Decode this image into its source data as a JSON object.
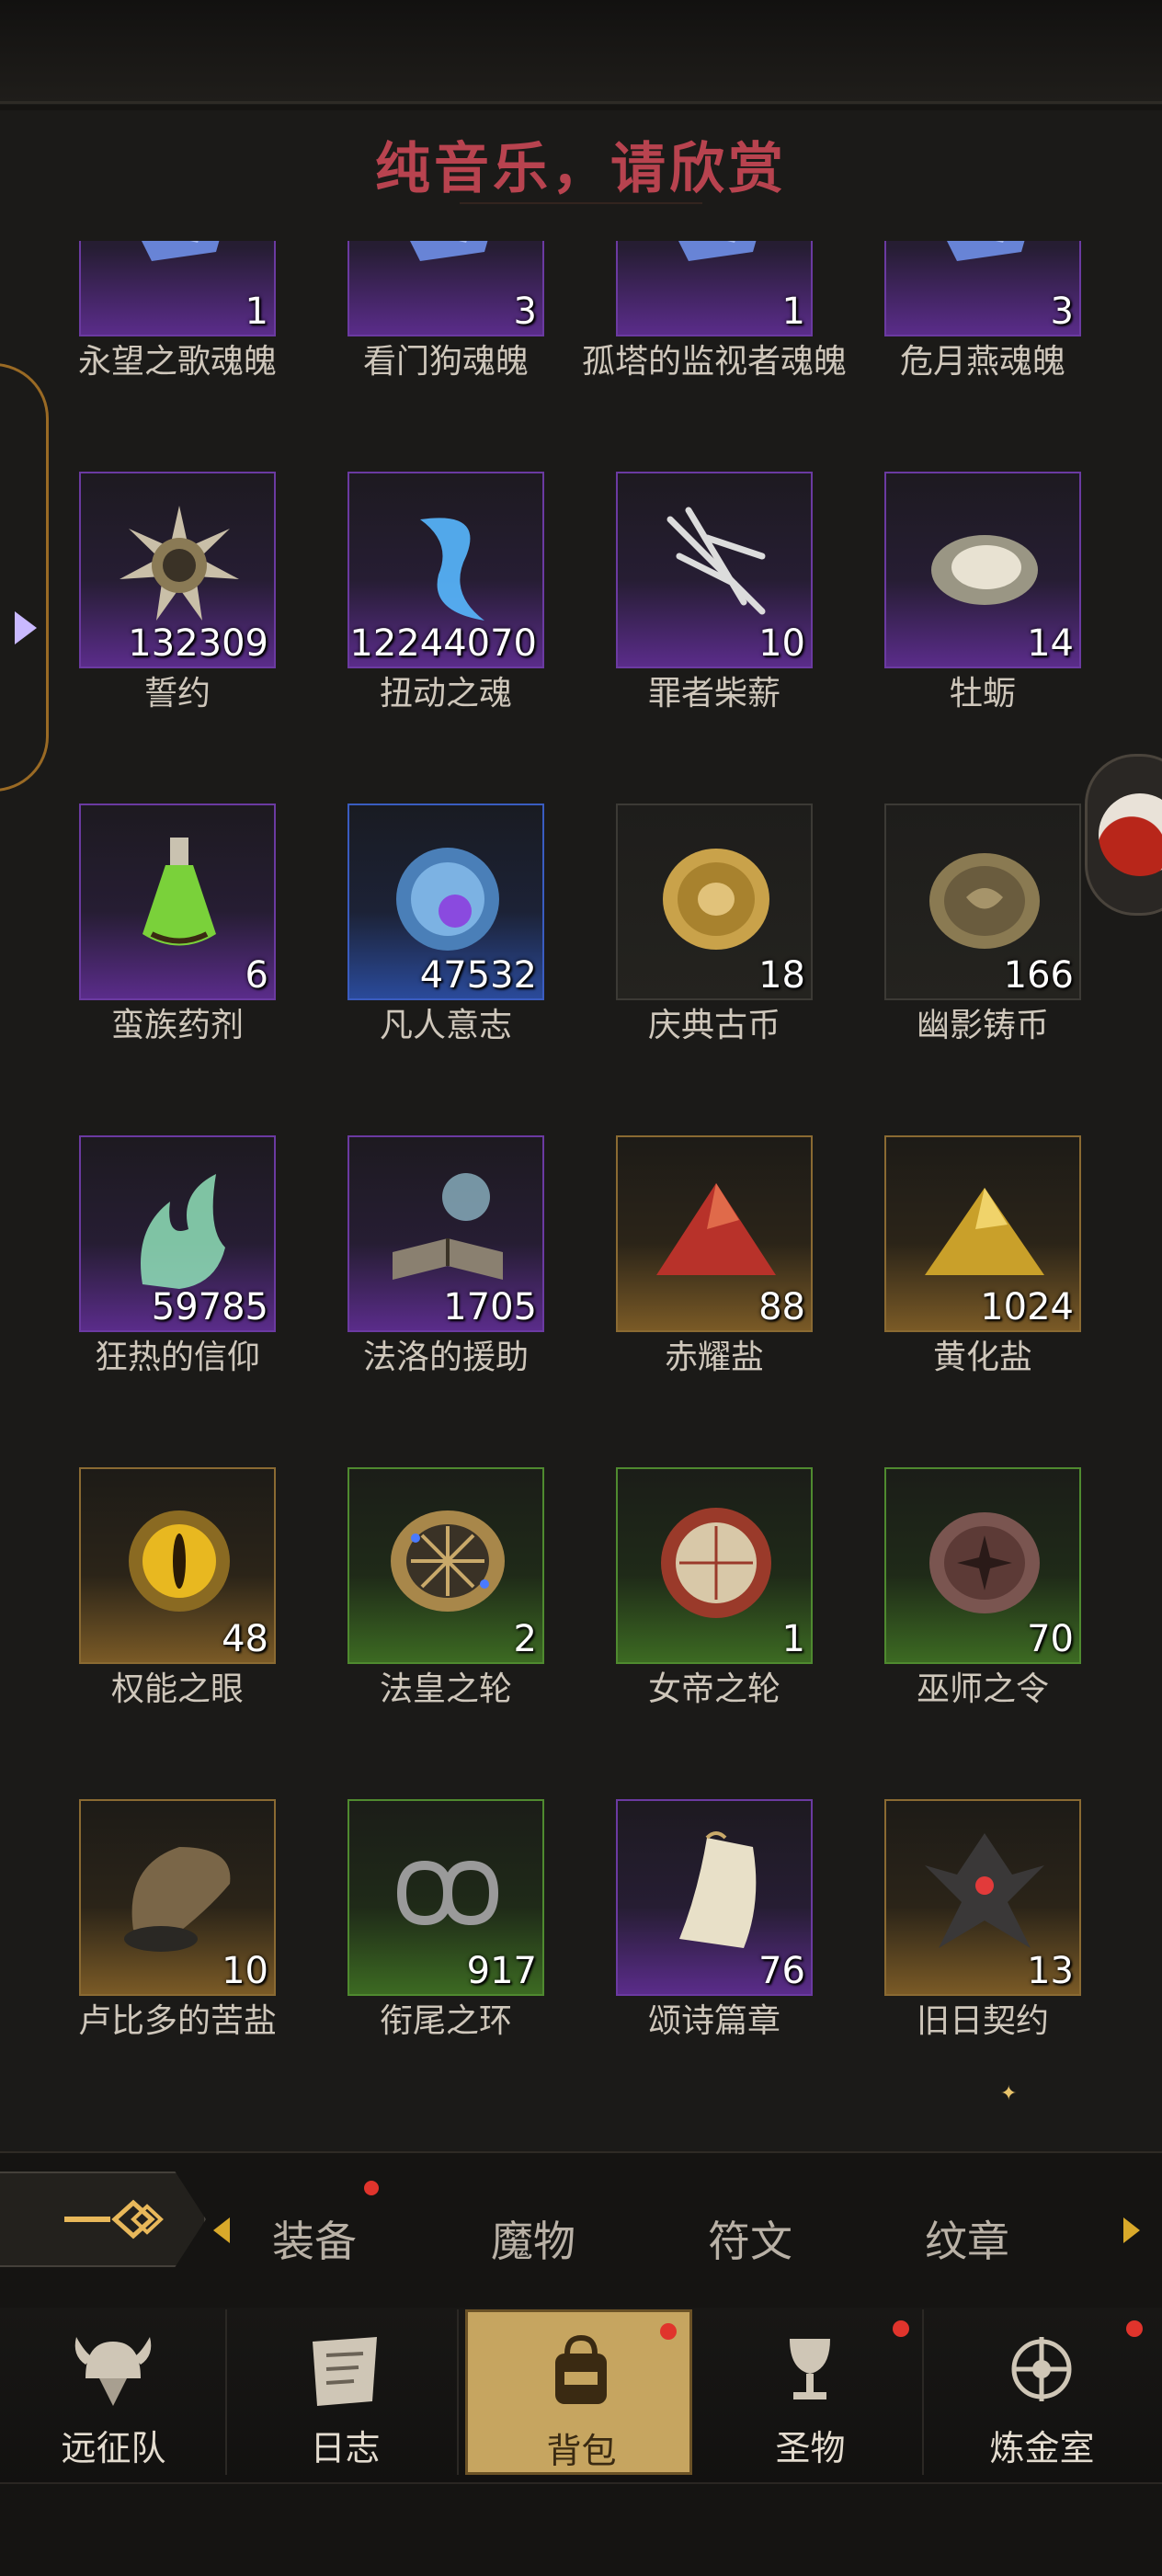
{
  "header": {
    "title": "纯音乐，请欣赏",
    "title_color": "#b8434f"
  },
  "items": [
    {
      "name": "永望之歌魂魄",
      "count": "1",
      "rarity": "purple",
      "icon": "crystal-icon"
    },
    {
      "name": "看门狗魂魄",
      "count": "3",
      "rarity": "purple",
      "icon": "crystal-icon"
    },
    {
      "name": "孤塔的监视者魂魄",
      "count": "1",
      "rarity": "purple",
      "icon": "crystal-icon"
    },
    {
      "name": "危月燕魂魄",
      "count": "3",
      "rarity": "purple",
      "icon": "crystal-icon"
    },
    {
      "name": "誓约",
      "count": "132309",
      "rarity": "purple",
      "icon": "star-seal-icon"
    },
    {
      "name": "扭动之魂",
      "count": "12244070",
      "rarity": "purple",
      "icon": "spirit-icon"
    },
    {
      "name": "罪者柴薪",
      "count": "10",
      "rarity": "purple",
      "icon": "branches-icon"
    },
    {
      "name": "牡蛎",
      "count": "14",
      "rarity": "purple",
      "icon": "oyster-icon"
    },
    {
      "name": "蛮族药剂",
      "count": "6",
      "rarity": "purple",
      "icon": "potion-icon"
    },
    {
      "name": "凡人意志",
      "count": "47532",
      "rarity": "blue",
      "icon": "orb-icon"
    },
    {
      "name": "庆典古币",
      "count": "18",
      "rarity": "grey",
      "icon": "gold-coin-icon"
    },
    {
      "name": "幽影铸币",
      "count": "166",
      "rarity": "grey",
      "icon": "bronze-coin-icon"
    },
    {
      "name": "狂热的信仰",
      "count": "59785",
      "rarity": "purple",
      "icon": "flame-icon"
    },
    {
      "name": "法洛的援助",
      "count": "1705",
      "rarity": "purple",
      "icon": "book-icon"
    },
    {
      "name": "赤耀盐",
      "count": "88",
      "rarity": "gold",
      "icon": "red-salt-icon"
    },
    {
      "name": "黄化盐",
      "count": "1024",
      "rarity": "gold",
      "icon": "yellow-salt-icon"
    },
    {
      "name": "权能之眼",
      "count": "48",
      "rarity": "gold",
      "icon": "eye-icon"
    },
    {
      "name": "法皇之轮",
      "count": "2",
      "rarity": "green",
      "icon": "wheel-icon"
    },
    {
      "name": "女帝之轮",
      "count": "1",
      "rarity": "green",
      "icon": "red-wheel-icon"
    },
    {
      "name": "巫师之令",
      "count": "70",
      "rarity": "green",
      "icon": "seal-coin-icon"
    },
    {
      "name": "卢比多的苦盐",
      "count": "10",
      "rarity": "gold",
      "icon": "salt-bag-icon"
    },
    {
      "name": "衔尾之环",
      "count": "917",
      "rarity": "green",
      "icon": "infinity-ring-icon"
    },
    {
      "name": "颂诗篇章",
      "count": "76",
      "rarity": "purple",
      "icon": "scroll-icon"
    },
    {
      "name": "旧日契约",
      "count": "13",
      "rarity": "gold",
      "icon": "dark-sigil-icon"
    }
  ],
  "category_tabs": {
    "items": [
      {
        "label": "装备",
        "has_dot": true
      },
      {
        "label": "魔物",
        "has_dot": false
      },
      {
        "label": "符文",
        "has_dot": false
      },
      {
        "label": "纹章",
        "has_dot": false
      }
    ]
  },
  "nav": {
    "items": [
      {
        "label": "远征队",
        "icon": "viking-helmet-icon",
        "active": false,
        "has_dot": false
      },
      {
        "label": "日志",
        "icon": "map-scroll-icon",
        "active": false,
        "has_dot": false
      },
      {
        "label": "背包",
        "icon": "backpack-icon",
        "active": true,
        "has_dot": true
      },
      {
        "label": "圣物",
        "icon": "chalice-icon",
        "active": false,
        "has_dot": true
      },
      {
        "label": "炼金室",
        "icon": "alchemy-icon",
        "active": false,
        "has_dot": true
      }
    ]
  },
  "colors": {
    "accent_gold": "#c6a560",
    "badge_red": "#e0342c",
    "purple_rarity": "#6b3aa1",
    "green_rarity": "#4f8a2f",
    "gold_rarity": "#8a6a32",
    "blue_rarity": "#3a5cc0"
  }
}
